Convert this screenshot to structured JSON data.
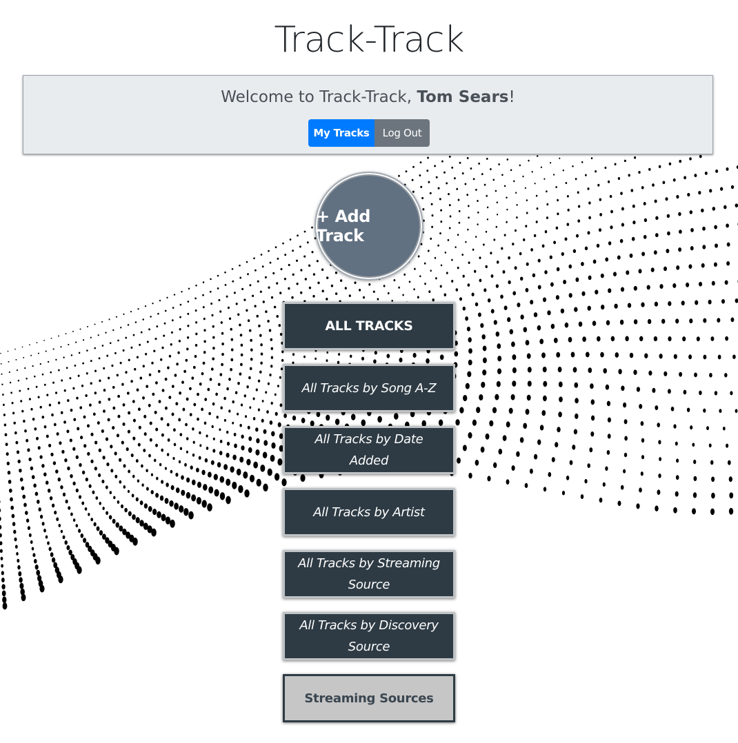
{
  "app": {
    "title": "Track-Track"
  },
  "welcome": {
    "greeting": "Welcome to Track-Track, ",
    "user_name": "Tom Sears",
    "suffix": "!",
    "my_tracks_label": "My Tracks",
    "logout_label": "Log Out"
  },
  "add_track": {
    "label": "+ Add Track"
  },
  "menu": {
    "all_tracks": "ALL TRACKS",
    "by_song": "All Tracks by Song A-Z",
    "by_date": "All Tracks by Date Added",
    "by_artist": "All Tracks by Artist",
    "by_streaming": "All Tracks by Streaming Source",
    "by_discovery": "All Tracks by Discovery Source",
    "streaming_sources": "Streaming Sources"
  },
  "colors": {
    "primary": "#007bff",
    "secondary": "#6c757d",
    "dark_button": "#2e3b44",
    "add_track": "#617182"
  },
  "background": {
    "pattern": "halftone-dot-wave"
  }
}
